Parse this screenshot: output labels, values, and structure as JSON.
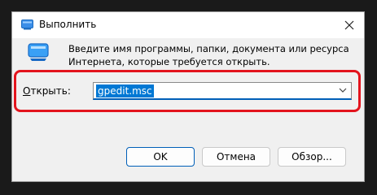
{
  "window": {
    "title": "Выполнить"
  },
  "dialog": {
    "description": "Введите имя программы, папки, документа или ресурса Интернета, которые требуется открыть.",
    "open_label": "Открыть:",
    "open_label_accel": "О",
    "open_label_rest": "ткрыть:",
    "command_value": "gpedit.msc"
  },
  "buttons": {
    "ok": "OK",
    "cancel": "Отмена",
    "browse": "Обзор..."
  },
  "colors": {
    "highlight": "#e3141d",
    "selection": "#0078d4",
    "accent": "#005fb8"
  },
  "icons": {
    "title": "run-icon",
    "close": "close-icon",
    "dialog": "run-icon",
    "dropdown": "chevron-down-icon"
  }
}
